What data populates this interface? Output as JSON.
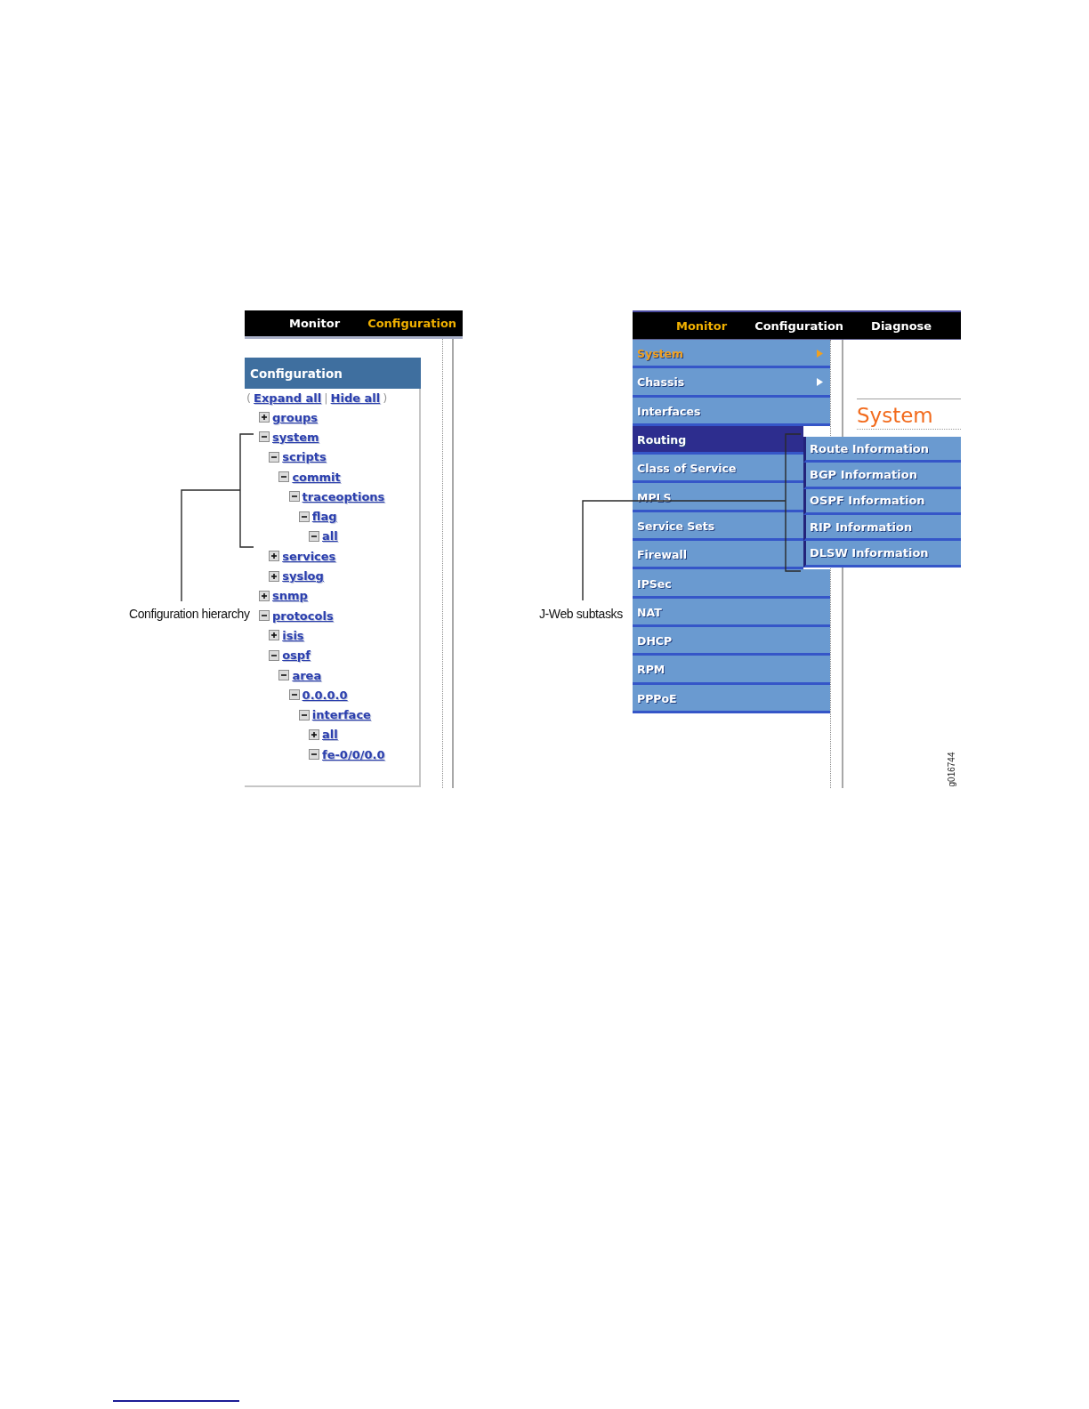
{
  "left_screenshot": {
    "nav_tabs": [
      {
        "label": "Monitor",
        "selected": false
      },
      {
        "label": "Configuration",
        "selected": true
      }
    ],
    "panel_title": "Configuration",
    "tree_actions": {
      "open": "(",
      "expand_link": "Expand all",
      "separator": "|",
      "hide_link": "Hide all",
      "close": ")"
    },
    "tree": [
      {
        "label": "groups",
        "expanded": false
      },
      {
        "label": "system",
        "expanded": true,
        "children": [
          {
            "label": "scripts",
            "expanded": true,
            "children": [
              {
                "label": "commit",
                "expanded": true,
                "children": [
                  {
                    "label": "traceoptions",
                    "expanded": true,
                    "children": [
                      {
                        "label": "flag",
                        "expanded": true,
                        "children": [
                          {
                            "label": "all",
                            "expanded": true
                          }
                        ]
                      }
                    ]
                  }
                ]
              }
            ]
          },
          {
            "label": "services",
            "expanded": false
          },
          {
            "label": "syslog",
            "expanded": false
          }
        ]
      },
      {
        "label": "snmp",
        "expanded": false
      },
      {
        "label": "protocols",
        "expanded": true,
        "children": [
          {
            "label": "isis",
            "expanded": false
          },
          {
            "label": "ospf",
            "expanded": true,
            "children": [
              {
                "label": "area",
                "expanded": true,
                "children": [
                  {
                    "label": "0.0.0.0",
                    "expanded": true,
                    "children": [
                      {
                        "label": "interface",
                        "expanded": true,
                        "children": [
                          {
                            "label": "all",
                            "expanded": false
                          },
                          {
                            "label": "fe-0/0/0.0",
                            "expanded": true
                          }
                        ]
                      }
                    ]
                  }
                ]
              }
            ]
          }
        ]
      }
    ]
  },
  "right_screenshot": {
    "nav_tabs": [
      {
        "label": "Monitor",
        "selected": true
      },
      {
        "label": "Configuration",
        "selected": false
      },
      {
        "label": "Diagnose",
        "selected": false
      }
    ],
    "menu": [
      {
        "label": "System",
        "selected": false,
        "current": true,
        "has_submenu": true
      },
      {
        "label": "Chassis",
        "selected": false,
        "current": false,
        "has_submenu": true
      },
      {
        "label": "Interfaces",
        "selected": false,
        "current": false,
        "has_submenu": false
      },
      {
        "label": "Routing",
        "selected": true,
        "current": false,
        "has_submenu": false
      },
      {
        "label": "Class of Service",
        "selected": false,
        "current": false,
        "has_submenu": false
      },
      {
        "label": "MPLS",
        "selected": false,
        "current": false,
        "has_submenu": false
      },
      {
        "label": "Service Sets",
        "selected": false,
        "current": false,
        "has_submenu": false
      },
      {
        "label": "Firewall",
        "selected": false,
        "current": false,
        "has_submenu": false
      },
      {
        "label": "IPSec",
        "selected": false,
        "current": false,
        "has_submenu": false
      },
      {
        "label": "NAT",
        "selected": false,
        "current": false,
        "has_submenu": false
      },
      {
        "label": "DHCP",
        "selected": false,
        "current": false,
        "has_submenu": false
      },
      {
        "label": "RPM",
        "selected": false,
        "current": false,
        "has_submenu": false
      },
      {
        "label": "PPPoE",
        "selected": false,
        "current": false,
        "has_submenu": false
      }
    ],
    "submenu": [
      {
        "label": "Route Information",
        "selected": false
      },
      {
        "label": "BGP Information",
        "selected": false
      },
      {
        "label": "OSPF Information",
        "selected": false
      },
      {
        "label": "RIP Information",
        "selected": false
      },
      {
        "label": "DLSW Information",
        "selected": false
      }
    ],
    "page_heading": "System"
  },
  "callouts": [
    {
      "label": "Configuration hierarchy"
    },
    {
      "label": "J-Web subtasks"
    }
  ],
  "figure_id": "g016744"
}
